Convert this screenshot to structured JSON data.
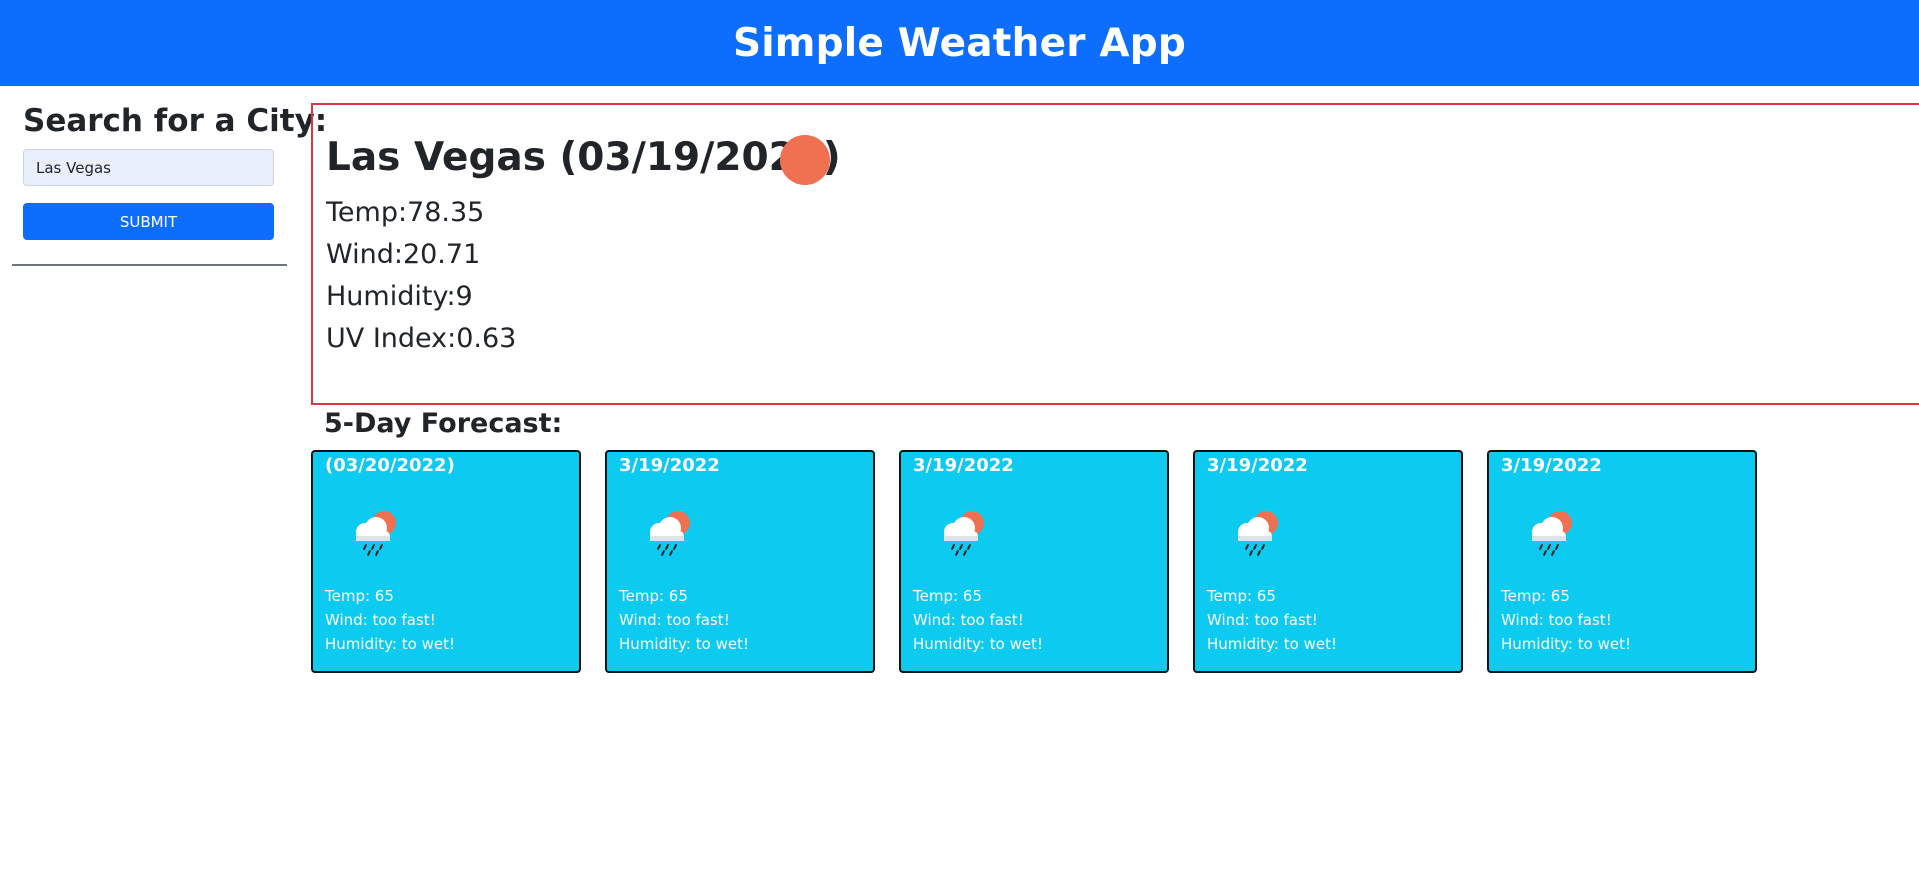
{
  "header": {
    "title": "Simple Weather App"
  },
  "sidebar": {
    "heading": "Search for a City:",
    "input_value": "Las Vegas",
    "submit_label": "SUBMIT"
  },
  "current": {
    "title": "Las Vegas (03/19/2022)",
    "icon": "sun-circle-icon",
    "icon_color": "#f07052",
    "temp": "Temp:78.35",
    "wind": "Wind:20.71",
    "humidity": "Humidity:9",
    "uv": "UV Index:0.63"
  },
  "forecast": {
    "heading": "5-Day Forecast:",
    "cards": [
      {
        "date": "(03/20/2022)",
        "icon": "rain-cloud-sun-icon",
        "temp": "Temp: 65",
        "wind": "Wind: too fast!",
        "humidity": "Humidity: to wet!"
      },
      {
        "date": "3/19/2022",
        "icon": "rain-cloud-sun-icon",
        "temp": "Temp: 65",
        "wind": "Wind: too fast!",
        "humidity": "Humidity: to wet!"
      },
      {
        "date": "3/19/2022",
        "icon": "rain-cloud-sun-icon",
        "temp": "Temp: 65",
        "wind": "Wind: too fast!",
        "humidity": "Humidity: to wet!"
      },
      {
        "date": "3/19/2022",
        "icon": "rain-cloud-sun-icon",
        "temp": "Temp: 65",
        "wind": "Wind: too fast!",
        "humidity": "Humidity: to wet!"
      },
      {
        "date": "3/19/2022",
        "icon": "rain-cloud-sun-icon",
        "temp": "Temp: 65",
        "wind": "Wind: too fast!",
        "humidity": "Humidity: to wet!"
      }
    ]
  },
  "colors": {
    "primary": "#0d6efd",
    "card_bg": "#0dcaf0",
    "current_border": "#dc3545"
  }
}
